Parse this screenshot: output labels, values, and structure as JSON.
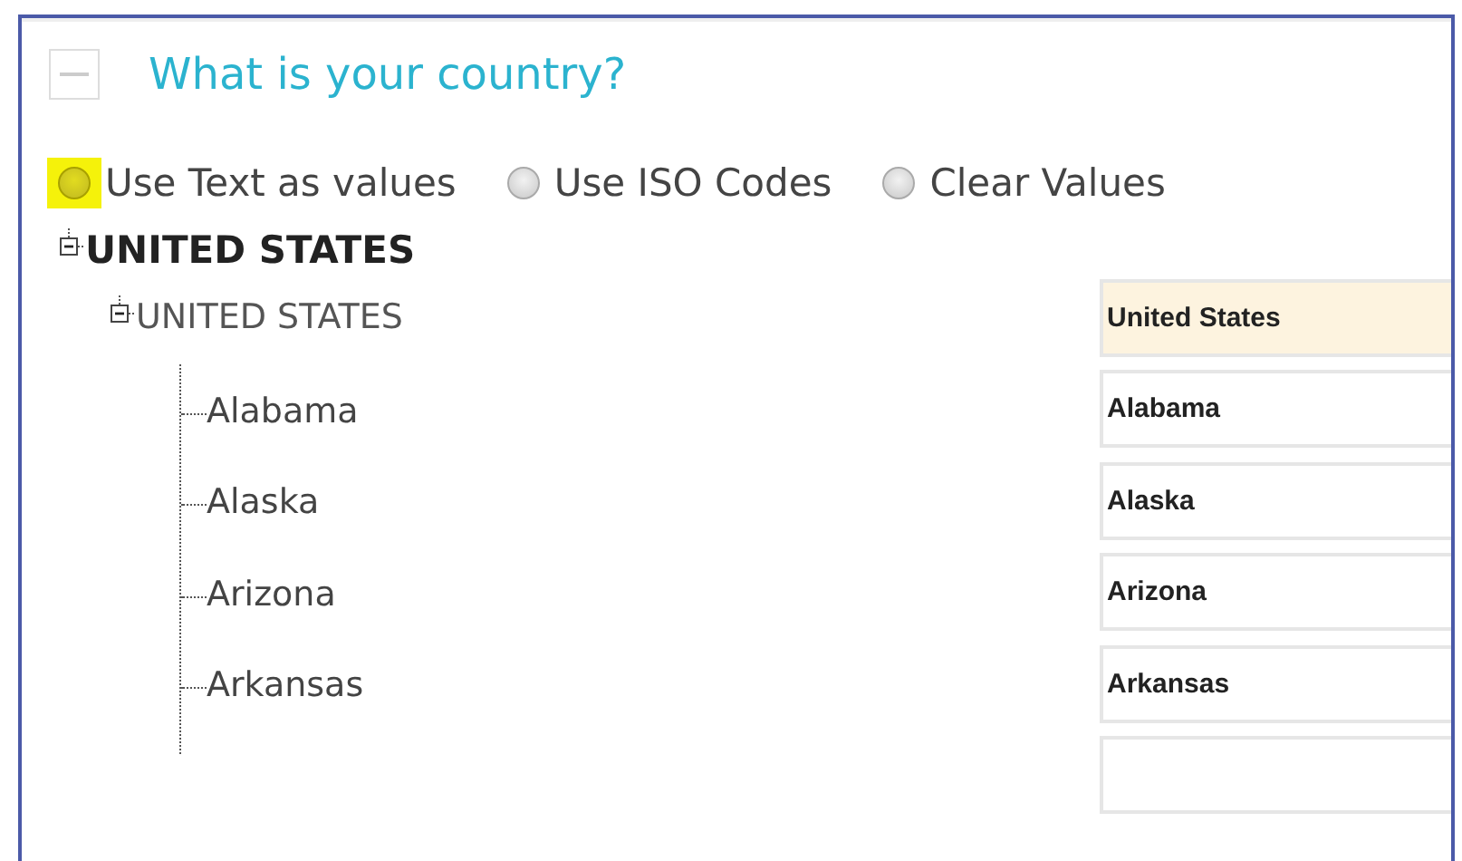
{
  "question": {
    "title": "What is your country?",
    "expanded": true
  },
  "options": [
    {
      "label": "Use Text as values",
      "selected": false,
      "highlighted": true
    },
    {
      "label": "Use ISO Codes",
      "selected": false,
      "highlighted": false
    },
    {
      "label": "Clear Values",
      "selected": false,
      "highlighted": false
    }
  ],
  "tree": {
    "label": "UNITED STATES",
    "expanded": true,
    "children": [
      {
        "label": "UNITED STATES",
        "expanded": true,
        "field": {
          "value": "United States",
          "highlighted": true
        },
        "children": [
          {
            "label": "Alabama",
            "field": {
              "value": "Alabama",
              "highlighted": false
            }
          },
          {
            "label": "Alaska",
            "field": {
              "value": "Alaska",
              "highlighted": false
            }
          },
          {
            "label": "Arizona",
            "field": {
              "value": "Arizona",
              "highlighted": false
            }
          },
          {
            "label": "Arkansas",
            "field": {
              "value": "Arkansas",
              "highlighted": false
            }
          }
        ]
      }
    ]
  },
  "extra_fields": [
    {
      "highlighted": false
    }
  ]
}
